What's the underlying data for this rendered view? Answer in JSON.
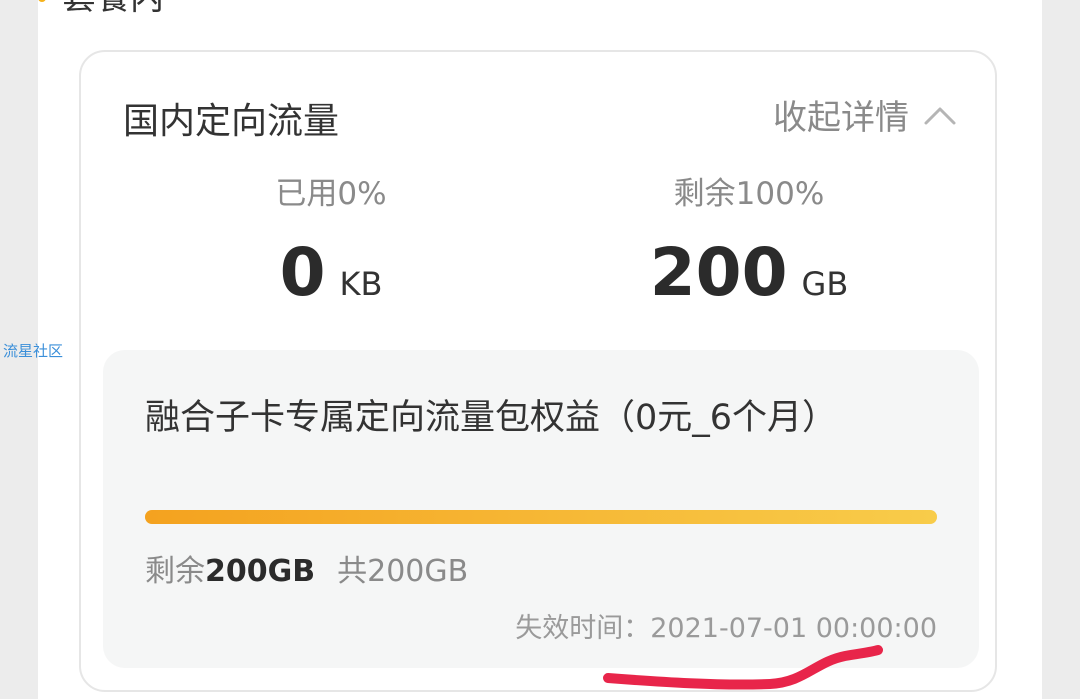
{
  "section": {
    "title": "套餐内"
  },
  "card": {
    "title": "国内定向流量",
    "collapse_label": "收起详情",
    "used": {
      "label": "已用0%",
      "value": "0",
      "unit": "KB"
    },
    "remaining": {
      "label": "剩余100%",
      "value": "200",
      "unit": "GB"
    }
  },
  "package": {
    "title": "融合子卡专属定向流量包权益（0元_6个月）",
    "remaining_prefix": "剩余",
    "remaining_value": "200GB",
    "total": "共200GB",
    "remaining_fraction": 1.0,
    "expire_label": "失效时间：",
    "expire_time": "2021-07-01 00:00:00"
  },
  "watermark": "流星社区",
  "colors": {
    "accent_dot": "#f5b21c",
    "progress_start": "#f4a21f",
    "progress_end": "#f8cc4a",
    "annotation_red": "#e8254a"
  },
  "icons": {
    "collapse": "chevron-up-icon"
  }
}
